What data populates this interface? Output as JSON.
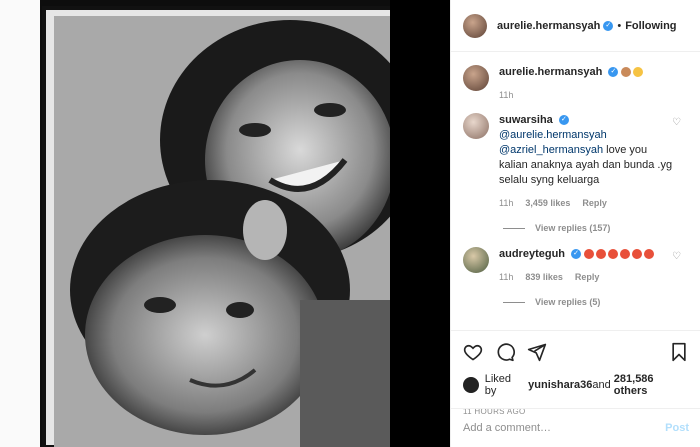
{
  "post": {
    "author": "aurelie.hermansyah",
    "follow_state": "Following"
  },
  "caption": {
    "username": "aurelie.hermansyah",
    "time": "11h"
  },
  "comments": [
    {
      "username": "suwarsiha",
      "mention1": "@aurelie.hermansyah",
      "mention2": "@azriel_hermansyah",
      "text": " love you kalian anaknya ayah dan bunda .yg selalu syng keluarga",
      "time": "11h",
      "likes": "3,459 likes",
      "reply": "Reply",
      "view_replies": "View replies (157)"
    },
    {
      "username": "audreyteguh",
      "time": "11h",
      "likes": "839 likes",
      "reply": "Reply",
      "view_replies": "View replies (5)"
    }
  ],
  "likes": {
    "prefix": "Liked by ",
    "user": "yunishara36",
    "middle": " and ",
    "count": "281,586 others"
  },
  "timestamp": "11 HOURS AGO",
  "add_comment": {
    "placeholder": "Add a comment…",
    "post_label": "Post"
  },
  "icons": [
    "heart-icon",
    "comment-icon",
    "share-icon",
    "bookmark-icon",
    "verified-icon"
  ],
  "colors": {
    "verified": "#3897f0",
    "link": "#00376b",
    "muted": "#8e8e8e",
    "post_disabled": "#b2dffc"
  }
}
